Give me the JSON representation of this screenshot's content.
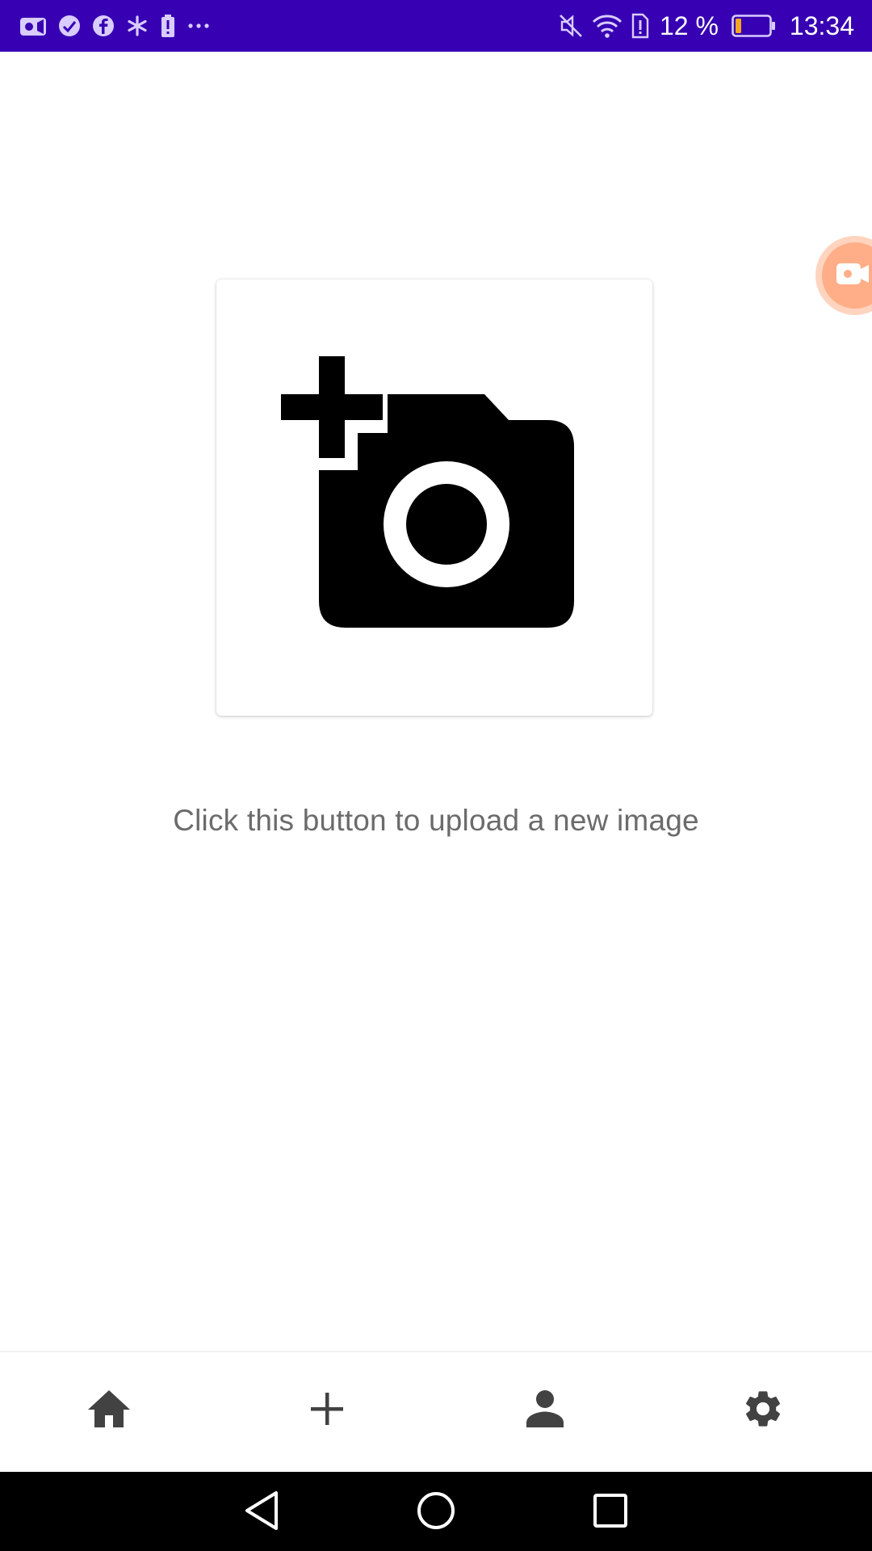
{
  "status_bar": {
    "battery_percent": "12 %",
    "time": "13:34",
    "battery_level": 0.12,
    "left_icons": [
      "video-camera-icon",
      "checkmark-circle-icon",
      "facebook-icon",
      "asterisk-icon",
      "battery-alert-icon",
      "more-dots-icon"
    ],
    "right_icons": [
      "mute-icon",
      "wifi-icon",
      "sim-alert-icon"
    ],
    "background_color": "#3700b3"
  },
  "main": {
    "upload_button_icon": "add-a-photo-icon",
    "caption": "Click this button to upload a new image"
  },
  "floating_widget": {
    "icon": "screen-recorder-icon",
    "color": "#ffae87"
  },
  "bottom_nav": {
    "items": [
      {
        "icon": "home-icon"
      },
      {
        "icon": "plus-icon"
      },
      {
        "icon": "person-icon"
      },
      {
        "icon": "settings-gear-icon"
      }
    ]
  },
  "system_nav": {
    "buttons": [
      "back-triangle-icon",
      "home-circle-icon",
      "recents-square-icon"
    ]
  }
}
